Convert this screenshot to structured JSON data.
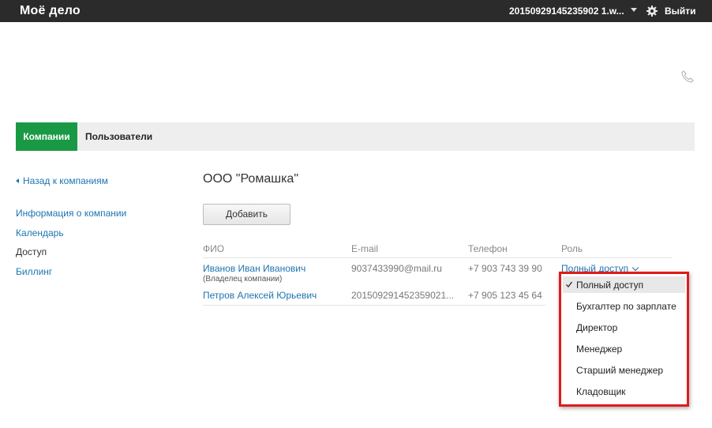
{
  "topbar": {
    "logo": "Моё дело",
    "account": "20150929145235902 1.w...",
    "logout_label": "Выйти",
    "icons": [
      "chevron-down-icon",
      "gear-icon"
    ]
  },
  "phone_icon": "phone-icon",
  "tabs": [
    {
      "label": "Компании",
      "active": true
    },
    {
      "label": "Пользователи",
      "active": false
    }
  ],
  "sidebar": {
    "back_label": "Назад к компаниям",
    "items": [
      {
        "label": "Информация о компании",
        "current": false
      },
      {
        "label": "Календарь",
        "current": false
      },
      {
        "label": "Доступ",
        "current": true
      },
      {
        "label": "Биллинг",
        "current": false
      }
    ]
  },
  "main": {
    "company_title": "ООО \"Ромашка\"",
    "add_button": "Добавить",
    "columns": [
      "ФИО",
      "E-mail",
      "Телефон",
      "Роль"
    ],
    "rows": [
      {
        "name": "Иванов Иван Иванович",
        "note": "(Владелец компании)",
        "email": "9037433990@mail.ru",
        "phone": "+7 903 743 39 90",
        "role": "Полный доступ"
      },
      {
        "name": "Петров Алексей Юрьевич",
        "note": "",
        "email": "201509291452359021...",
        "phone": "+7 905 123 45 64",
        "role": ""
      }
    ]
  },
  "role_dropdown": {
    "selected": "Полный доступ",
    "options": [
      "Полный доступ",
      "Бухгалтер по зарплате",
      "Директор",
      "Менеджер",
      "Старший менеджер",
      "Кладовщик"
    ],
    "highlight_color": "#e01b1b"
  },
  "colors": {
    "brand_green": "#1a9945",
    "link_blue": "#1d74b0",
    "topbar": "#2b2b2b"
  }
}
